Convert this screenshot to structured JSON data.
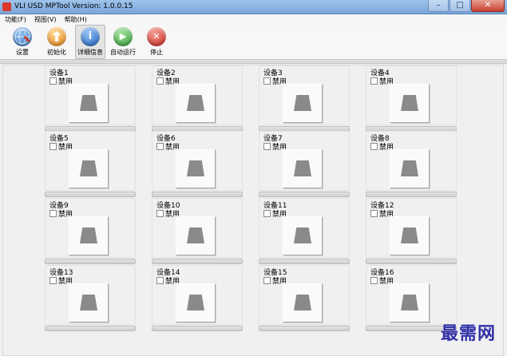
{
  "window": {
    "title": "VLI USD MPTool   Version: 1.0.0.15",
    "minimize_symbol": "–",
    "maximize_symbol": "□",
    "close_symbol": "✕"
  },
  "menu": [
    "功能(F)",
    "视图(V)",
    "帮助(H)"
  ],
  "toolbar": {
    "settings": {
      "label": "设置",
      "icon": "settings-globe-icon",
      "color": "#2f6fc0"
    },
    "init": {
      "label": "初始化",
      "icon": "init-icon",
      "color": "#f0a030"
    },
    "details": {
      "label": "详细信息",
      "icon": "info-icon",
      "color": "#2e74d4",
      "glyph": "i"
    },
    "auto_run": {
      "label": "自动运行",
      "icon": "play-icon",
      "color": "#3cb043",
      "glyph": "▶"
    },
    "stop": {
      "label": "停止",
      "icon": "stop-icon",
      "color": "#d8302a",
      "glyph": "✕"
    }
  },
  "disable_label": "禁用",
  "devices": [
    {
      "name": "设备1"
    },
    {
      "name": "设备2"
    },
    {
      "name": "设备3"
    },
    {
      "name": "设备4"
    },
    {
      "name": "设备5"
    },
    {
      "name": "设备6"
    },
    {
      "name": "设备7"
    },
    {
      "name": "设备8"
    },
    {
      "name": "设备9"
    },
    {
      "name": "设备10"
    },
    {
      "name": "设备11"
    },
    {
      "name": "设备12"
    },
    {
      "name": "设备13"
    },
    {
      "name": "设备14"
    },
    {
      "name": "设备15"
    },
    {
      "name": "设备16"
    }
  ],
  "watermark": "最需网"
}
